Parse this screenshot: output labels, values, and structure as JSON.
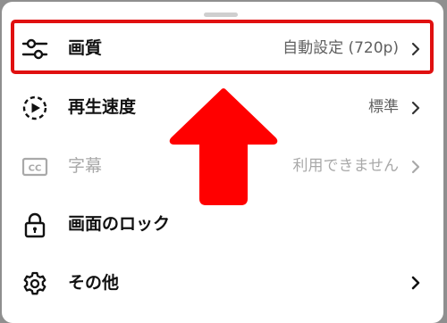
{
  "menu": {
    "items": [
      {
        "label": "画質",
        "value": "自動設定 (720p)",
        "icon": "sliders-icon",
        "enabled": true
      },
      {
        "label": "再生速度",
        "value": "標準",
        "icon": "playback-speed-icon",
        "enabled": true
      },
      {
        "label": "字幕",
        "value": "利用できません",
        "icon": "closed-captions-icon",
        "enabled": false
      },
      {
        "label": "画面のロック",
        "value": "",
        "icon": "lock-icon",
        "enabled": true
      },
      {
        "label": "その他",
        "value": "",
        "icon": "gear-icon",
        "enabled": true
      }
    ],
    "chevron_icon": "chevron-right-icon"
  },
  "annotation": {
    "highlight_color": "#e01010",
    "arrow_icon": "red-up-arrow",
    "arrow_color": "#ff0000"
  }
}
